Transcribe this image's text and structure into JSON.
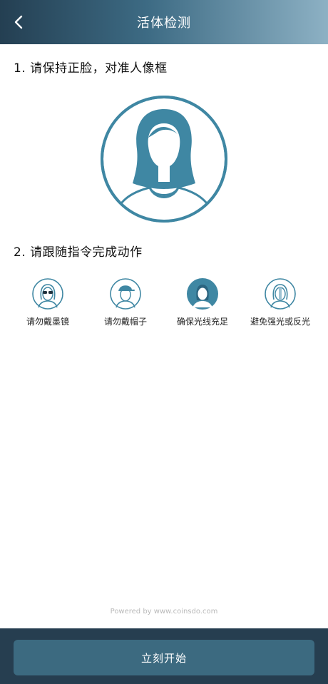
{
  "header": {
    "title": "活体检测",
    "back_icon": "chevron-left-icon"
  },
  "steps": [
    {
      "label": "1. 请保持正脸，对准人像框"
    },
    {
      "label": "2. 请跟随指令完成动作"
    }
  ],
  "face_frame": {
    "icon": "face-portrait-icon",
    "color": "#3f87a3"
  },
  "tips": [
    {
      "label": "请勿戴墨镜",
      "icon": "no-sunglasses-icon"
    },
    {
      "label": "请勿戴帽子",
      "icon": "no-hat-icon"
    },
    {
      "label": "确保光线充足",
      "icon": "good-lighting-icon"
    },
    {
      "label": "避免强光或反光",
      "icon": "avoid-glare-icon"
    }
  ],
  "powered_by": "Powered by www.coinsdo.com",
  "footer": {
    "start_button": "立刻开始"
  },
  "colors": {
    "accent": "#3f87a3",
    "button": "#3c6a80",
    "footer_bg": "#263e50"
  }
}
